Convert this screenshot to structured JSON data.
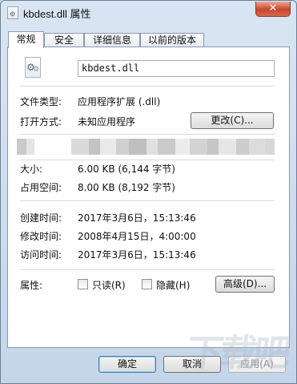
{
  "window": {
    "title": "kbdest.dll 属性",
    "close_glyph": "✕"
  },
  "tabs": [
    {
      "label": "常规",
      "active": true
    },
    {
      "label": "安全",
      "active": false
    },
    {
      "label": "详细信息",
      "active": false
    },
    {
      "label": "以前的版本",
      "active": false
    }
  ],
  "general": {
    "file_name": "kbdest.dll",
    "file_type_label": "文件类型:",
    "file_type_value": "应用程序扩展 (.dll)",
    "open_with_label": "打开方式:",
    "open_with_value": "未知应用程序",
    "change_button": "更改(C)...",
    "size_label": "大小:",
    "size_value": "6.00 KB (6,144 字节)",
    "size_on_disk_label": "占用空间:",
    "size_on_disk_value": "8.00 KB (8,192 字节)",
    "created_label": "创建时间:",
    "created_value": "2017年3月6日，15:13:46",
    "modified_label": "修改时间:",
    "modified_value": "2008年4月15日，4:00:00",
    "accessed_label": "访问时间:",
    "accessed_value": "2017年3月6日，15:13:46",
    "attributes_label": "属性:",
    "readonly_label": "只读(R)",
    "hidden_label": "隐藏(H)",
    "advanced_button": "高级(D)..."
  },
  "footer": {
    "ok_button": "确定",
    "cancel_button": "取消",
    "apply_button": "应用(A)"
  },
  "colors": {
    "window_frame": "#c4d5ea",
    "close_button": "#c8452c",
    "default_button_border": "#3c7fb1"
  },
  "icons": {
    "title": "dll-file-icon",
    "file": "dll-file-icon",
    "close": "close-icon"
  }
}
